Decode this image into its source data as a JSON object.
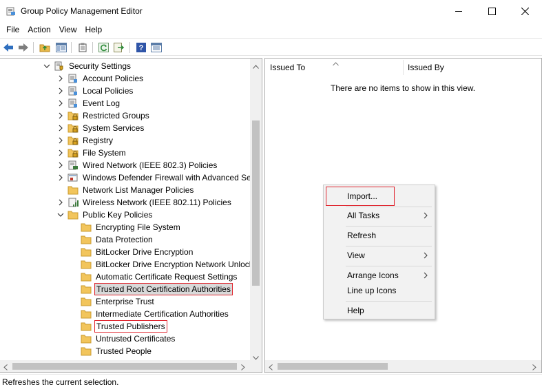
{
  "window": {
    "title": "Group Policy Management Editor"
  },
  "menu": {
    "items": [
      "File",
      "Action",
      "View",
      "Help"
    ]
  },
  "tree": {
    "nodes": [
      {
        "label": "Security Settings",
        "expanded": true
      },
      {
        "label": "Account Policies"
      },
      {
        "label": "Local Policies"
      },
      {
        "label": "Event Log"
      },
      {
        "label": "Restricted Groups"
      },
      {
        "label": "System Services"
      },
      {
        "label": "Registry"
      },
      {
        "label": "File System"
      },
      {
        "label": "Wired Network (IEEE 802.3) Policies"
      },
      {
        "label": "Windows Defender Firewall with Advanced Sec"
      },
      {
        "label": "Network List Manager Policies"
      },
      {
        "label": "Wireless Network (IEEE 802.11) Policies"
      },
      {
        "label": "Public Key Policies",
        "expanded": true
      },
      {
        "label": "Encrypting File System"
      },
      {
        "label": "Data Protection"
      },
      {
        "label": "BitLocker Drive Encryption"
      },
      {
        "label": "BitLocker Drive Encryption Network Unlock"
      },
      {
        "label": "Automatic Certificate Request Settings"
      },
      {
        "label": "Trusted Root Certification Authorities",
        "highlighted": true
      },
      {
        "label": "Enterprise Trust"
      },
      {
        "label": "Intermediate Certification Authorities"
      },
      {
        "label": "Trusted Publishers",
        "highlighted": true
      },
      {
        "label": "Untrusted Certificates"
      },
      {
        "label": "Trusted People"
      }
    ]
  },
  "list": {
    "columns": [
      "Issued To",
      "Issued By"
    ],
    "empty_message": "There are no items to show in this view."
  },
  "context_menu": {
    "items": [
      {
        "label": "Import...",
        "highlighted": true
      },
      {
        "label": "All Tasks",
        "submenu": true
      },
      {
        "label": "Refresh"
      },
      {
        "label": "View",
        "submenu": true
      },
      {
        "label": "Arrange Icons",
        "submenu": true
      },
      {
        "label": "Line up Icons"
      },
      {
        "label": "Help"
      }
    ]
  },
  "status": {
    "text": "Refreshes the current selection."
  },
  "colors": {
    "highlight_border": "#e0262f",
    "folder": "#f2c55c",
    "toolbar_blue": "#2f6fbf"
  }
}
